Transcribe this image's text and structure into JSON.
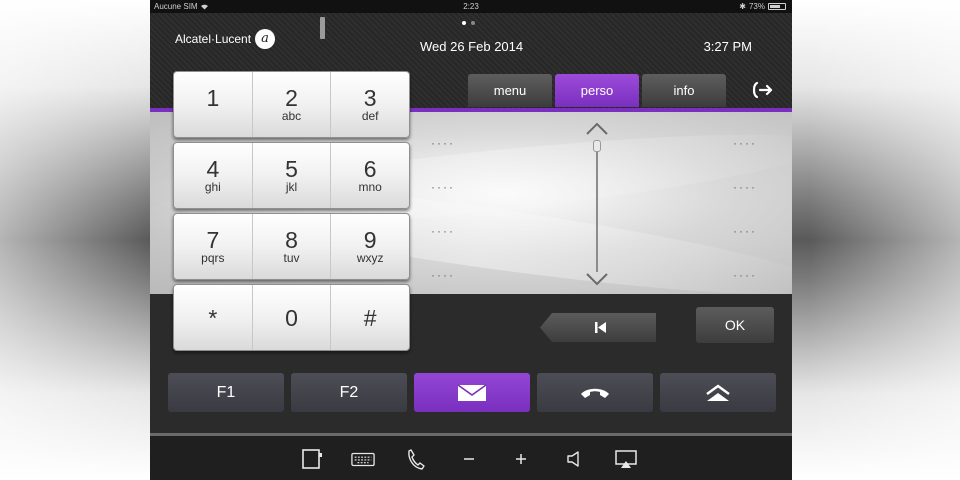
{
  "status_bar": {
    "carrier": "Aucune SIM",
    "clock": "2:23",
    "battery": "73%",
    "battery_fraction": 0.73
  },
  "header": {
    "brand": "Alcatel·Lucent",
    "date": "Wed 26 Feb 2014",
    "time": "3:27 PM",
    "tabs": [
      {
        "label": "menu",
        "active": false
      },
      {
        "label": "perso",
        "active": true
      },
      {
        "label": "info",
        "active": false
      }
    ]
  },
  "panel": {
    "placeholder": "····"
  },
  "dialpad": {
    "rows": [
      [
        {
          "digit": "1",
          "letters": ""
        },
        {
          "digit": "2",
          "letters": "abc"
        },
        {
          "digit": "3",
          "letters": "def"
        }
      ],
      [
        {
          "digit": "4",
          "letters": "ghi"
        },
        {
          "digit": "5",
          "letters": "jkl"
        },
        {
          "digit": "6",
          "letters": "mno"
        }
      ],
      [
        {
          "digit": "7",
          "letters": "pqrs"
        },
        {
          "digit": "8",
          "letters": "tuv"
        },
        {
          "digit": "9",
          "letters": "wxyz"
        }
      ],
      [
        {
          "digit": "*",
          "letters": ""
        },
        {
          "digit": "0",
          "letters": ""
        },
        {
          "digit": "#",
          "letters": ""
        }
      ]
    ]
  },
  "nav": {
    "ok_label": "OK"
  },
  "function_keys": {
    "f1": "F1",
    "f2": "F2"
  },
  "colors": {
    "accent": "#7b2fbf",
    "button": "#3a3a42",
    "background": "#2b2b2b"
  },
  "icons": {
    "exit": "exit-arrow-icon",
    "skip": "skip-back-icon",
    "mail": "envelope-icon",
    "hangup": "hangup-icon",
    "expand": "eject-up-icon",
    "toolbar": [
      "contacts-book-icon",
      "keyboard-icon",
      "phone-handset-icon",
      "minus-icon",
      "plus-icon",
      "speaker-icon",
      "airplay-icon"
    ]
  }
}
